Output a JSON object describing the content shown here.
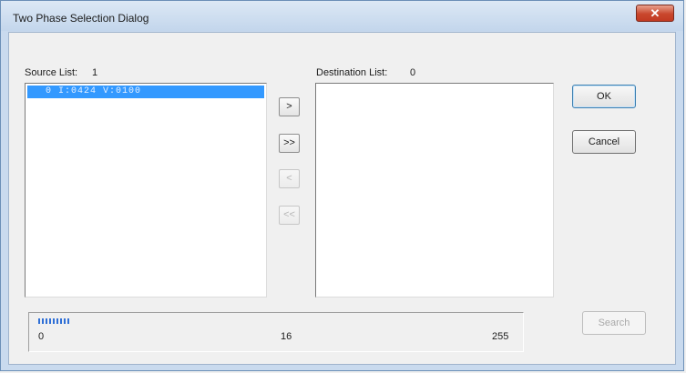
{
  "window": {
    "title": "Two Phase Selection Dialog",
    "close_glyph": "✕"
  },
  "source": {
    "label": "Source List:",
    "count": "1",
    "items": [
      "0 I:0424 V:0100"
    ]
  },
  "destination": {
    "label": "Destination List:",
    "count": "0",
    "items": []
  },
  "transfer_buttons": {
    "move_one": ">",
    "move_all": ">>",
    "remove_one": "<",
    "remove_all": "<<"
  },
  "buttons": {
    "ok": "OK",
    "cancel": "Cancel",
    "search": "Search"
  },
  "progress": {
    "min_label": "0",
    "mid_label": "16",
    "max_label": "255",
    "fill_fraction": 0.07
  },
  "colors": {
    "selection": "#3399ff",
    "progress": "#2f6fd6",
    "close_button": "#c9472d"
  }
}
